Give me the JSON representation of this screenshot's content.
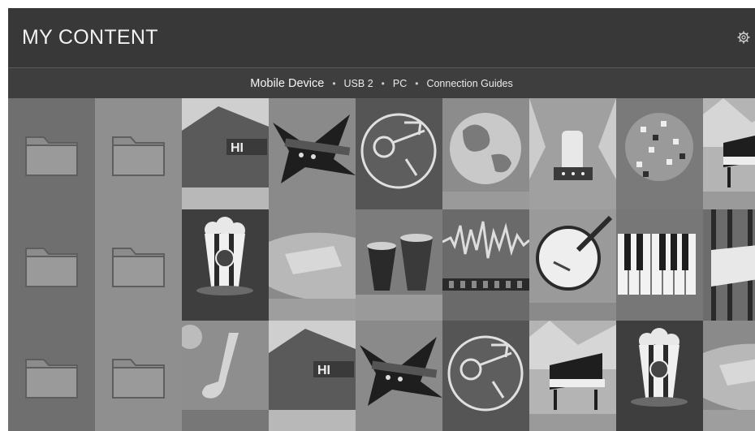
{
  "header": {
    "title": "MY CONTENT",
    "settings_icon": "gear-icon"
  },
  "sources": {
    "items": [
      "Mobile Device",
      "USB 2",
      "PC",
      "Connection Guides"
    ],
    "selected": "Mobile Device",
    "separator": "•"
  },
  "grid": {
    "rows": [
      [
        "folder",
        "folder",
        "movie-tent",
        "electric-guitar",
        "guitarist-badge",
        "globe",
        "rock-hand",
        "disco-ball",
        "grand-piano"
      ],
      [
        "folder",
        "folder",
        "popcorn-music",
        "cowboy-hat",
        "bongo-drums",
        "sound-wave",
        "banjo",
        "piano-keys",
        "sheet-music"
      ],
      [
        "folder",
        "folder",
        "saxophone",
        "movie-tent",
        "electric-guitar",
        "guitarist-badge",
        "grand-piano",
        "popcorn-music",
        "cowboy-hat"
      ]
    ]
  }
}
